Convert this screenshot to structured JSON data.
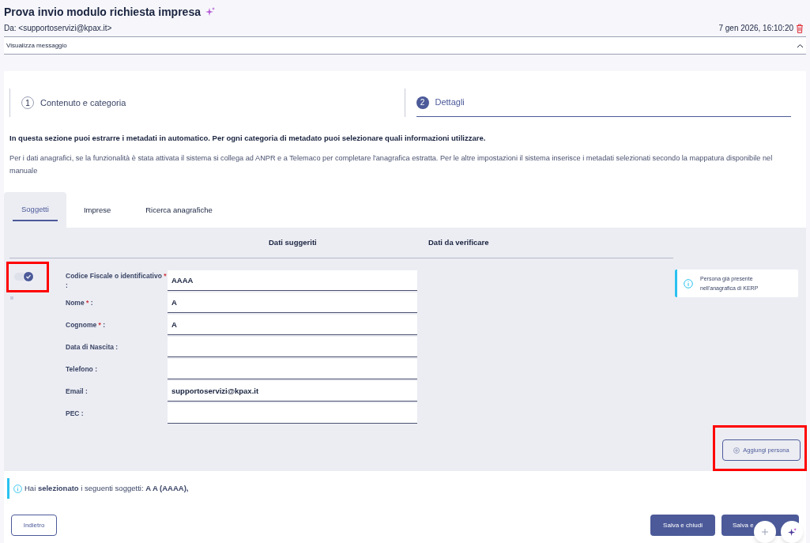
{
  "message": {
    "title": "Prova invio modulo richiesta impresa",
    "from": "Da: <supportoservizi@kpax.it>",
    "date": "7 gen 2026, 16:10:20",
    "toggle_label": "Visualizza messaggio",
    "expanded": true
  },
  "steps": [
    {
      "number": "1",
      "label": "Contenuto e categoria",
      "selected": false
    },
    {
      "number": "2",
      "label": "Dettagli",
      "selected": true
    }
  ],
  "intro": "In questa sezione puoi estrarre i metadati in automatico. Per ogni categoria di metadato puoi selezionare quali informazioni utilizzare.",
  "description": "Per i dati anagrafici, se la funzionalità è stata attivata il sistema si collega ad ANPR e a Telemaco per completare l'anagrafica estratta. Per le altre impostazioni il sistema inserisce i metadati selezionati secondo la mappatura disponibile nel manuale",
  "tabs": [
    {
      "label": "Soggetti",
      "selected": true
    },
    {
      "label": "Imprese",
      "selected": false
    },
    {
      "label": "Ricerca anagrafiche",
      "selected": false
    }
  ],
  "columns": [
    "Dati suggeriti",
    "Dati da verificare"
  ],
  "person": {
    "on": true,
    "fields": [
      {
        "label": "Codice Fiscale o identificativo",
        "required_mark": "*",
        "suffix": ":",
        "value": "AAAA"
      },
      {
        "label": "Nome",
        "required_mark": "*",
        "suffix": ":",
        "value": "A"
      },
      {
        "label": "Cognome",
        "required_mark": "*",
        "suffix": ":",
        "value": "A"
      },
      {
        "label": "Data di Nascita",
        "suffix": ":"
      },
      {
        "label": "Telefono",
        "suffix": ":"
      },
      {
        "label": "Email",
        "suffix": ":",
        "value": "supportoservizi@kpax.it"
      },
      {
        "label": "PEC",
        "suffix": ":"
      }
    ],
    "notice": "Persona già presente nell'anagrafica di KERP"
  },
  "add_button": "Aggiungi persona",
  "summary": "Hai **selezionato** i seguenti soggetti: **A A (AAAA),**",
  "buttons": [
    {
      "label": "Indietro",
      "kind": "outline"
    },
    {
      "label": "Salva e chiudi",
      "kind": "filled"
    },
    {
      "label": "Salva e",
      "kind": "filled"
    }
  ]
}
